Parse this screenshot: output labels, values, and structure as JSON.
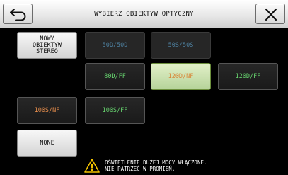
{
  "header": {
    "title": "WYBIERZ OBIEKTYW OPTYCZNY",
    "back_icon": "back-arrow-icon",
    "close_icon": "close-x-icon"
  },
  "options": {
    "new_stereo": "NOWY OBIEKTYW STEREO",
    "o50d_50d": "50D/50D",
    "o50s_50s": "50S/50S",
    "o80d_ff": "80D/FF",
    "o120d_nf": "120D/NF",
    "o120d_ff": "120D/FF",
    "o100s_nf": "100S/NF",
    "o100s_ff": "100S/FF",
    "none": "NONE"
  },
  "selected_option": "120D/NF",
  "warning": {
    "icon": "warning-triangle-icon",
    "line1": "OŚWIETLENIE DUŻEJ MOCY WŁĄCZONE.",
    "line2": "NIE PATRZEĆ W PROMIEŃ."
  },
  "colors": {
    "green_text": "#67d46f",
    "orange_text": "#e88e4c",
    "disabled_text": "#4d7f9e",
    "selected_bg": "#c9e2b0"
  }
}
